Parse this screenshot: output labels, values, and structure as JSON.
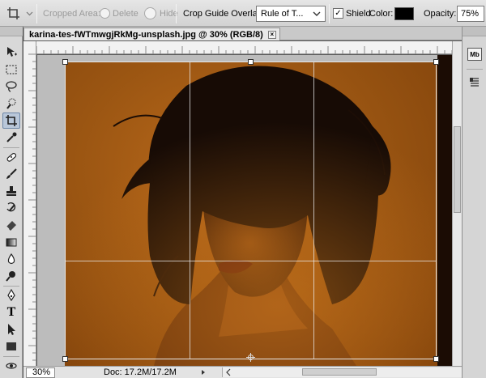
{
  "options_bar": {
    "tool_icon": "crop-icon",
    "cropped_area_label": "Cropped Area:",
    "delete_label": "Delete",
    "hide_label": "Hide",
    "crop_guide_label": "Crop Guide Overlay:",
    "crop_guide_value": "Rule of T...",
    "shield_label": "Shield",
    "shield_checked": true,
    "color_label": "Color:",
    "shield_color": "#000000",
    "opacity_label": "Opacity:",
    "opacity_value": "75%"
  },
  "document": {
    "tab_title": "karina-tes-fWTmwgjRkMg-unsplash.jpg @ 30% (RGB/8)",
    "close_glyph": "×"
  },
  "status_bar": {
    "zoom": "30%",
    "doc_info": "Doc: 17.2M/17.2M"
  },
  "toolbox": {
    "tools": [
      {
        "name": "move-tool",
        "icon": "move-icon"
      },
      {
        "name": "marquee-tool",
        "icon": "marquee-icon"
      },
      {
        "name": "lasso-tool",
        "icon": "lasso-icon"
      },
      {
        "name": "quick-selection-tool",
        "icon": "quick-selection-icon"
      },
      {
        "name": "crop-tool",
        "icon": "crop-icon",
        "active": true
      },
      {
        "name": "eyedropper-tool",
        "icon": "eyedropper-icon"
      },
      {
        "name": "healing-brush-tool",
        "icon": "bandage-icon"
      },
      {
        "name": "brush-tool",
        "icon": "brush-icon"
      },
      {
        "name": "clone-stamp-tool",
        "icon": "stamp-icon"
      },
      {
        "name": "history-brush-tool",
        "icon": "history-brush-icon"
      },
      {
        "name": "eraser-tool",
        "icon": "eraser-icon"
      },
      {
        "name": "gradient-tool",
        "icon": "gradient-icon"
      },
      {
        "name": "blur-tool",
        "icon": "droplet-icon"
      },
      {
        "name": "dodge-tool",
        "icon": "dodge-icon"
      },
      {
        "name": "pen-tool",
        "icon": "pen-icon"
      },
      {
        "name": "type-tool",
        "icon": "type-icon"
      },
      {
        "name": "path-selection-tool",
        "icon": "arrow-cursor-icon"
      },
      {
        "name": "shape-tool",
        "icon": "rectangle-icon"
      },
      {
        "name": "3d-rotate-tool",
        "icon": "3d-rotate-icon"
      }
    ],
    "type_glyph": "T"
  },
  "dock": {
    "mini_bridge_label": "Mb",
    "panel_icon": "paragraph-panel-icon"
  },
  "colors": {
    "accent_active_tool": "#b9c7d9",
    "crop_border": "#e8e8e8",
    "photo_base": "#9a5512"
  }
}
